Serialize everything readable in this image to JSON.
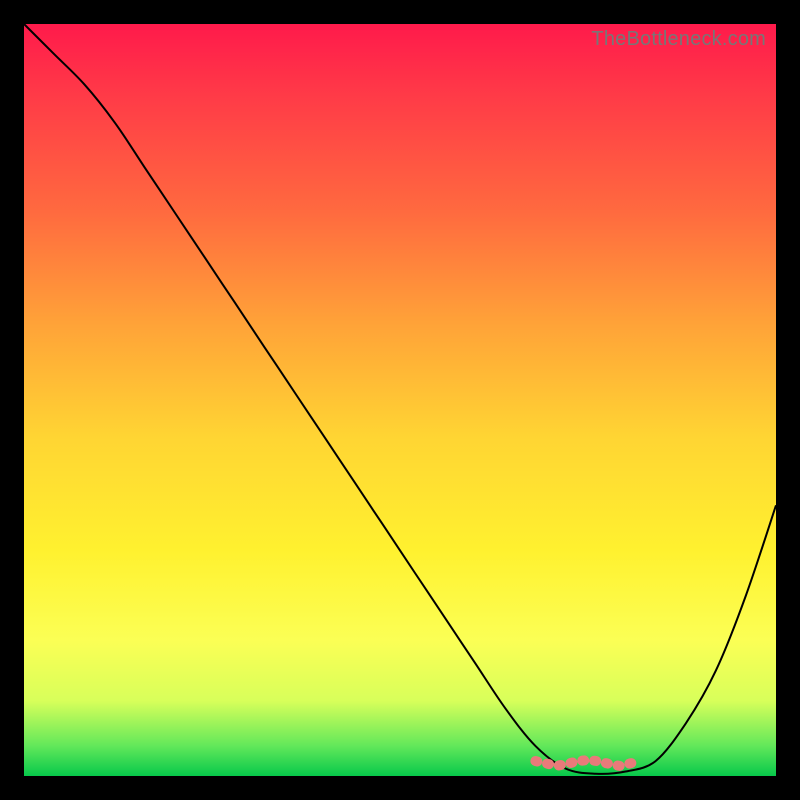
{
  "watermark": "TheBottleneck.com",
  "colors": {
    "gradient_top": "#ff1a4b",
    "gradient_bottom": "#07c84b",
    "curve": "#000000",
    "min_marker": "#e97a7a",
    "frame": "#000000"
  },
  "chart_data": {
    "type": "line",
    "title": "",
    "xlabel": "",
    "ylabel": "",
    "xlim": [
      0,
      100
    ],
    "ylim": [
      0,
      100
    ],
    "grid": false,
    "series": [
      {
        "name": "bottleneck-curve",
        "x": [
          0,
          4,
          8,
          12,
          16,
          20,
          24,
          28,
          32,
          36,
          40,
          44,
          48,
          52,
          56,
          60,
          64,
          68,
          72,
          76,
          80,
          84,
          88,
          92,
          96,
          100
        ],
        "y": [
          100,
          96,
          92,
          87,
          81,
          75,
          69,
          63,
          57,
          51,
          45,
          39,
          33,
          27,
          21,
          15,
          9,
          4,
          1,
          0.3,
          0.6,
          2,
          7,
          14,
          24,
          36
        ]
      }
    ],
    "annotations": [
      {
        "name": "minimum-region",
        "x_start": 68,
        "x_end": 82,
        "note": "pink marker near curve minimum"
      }
    ]
  }
}
